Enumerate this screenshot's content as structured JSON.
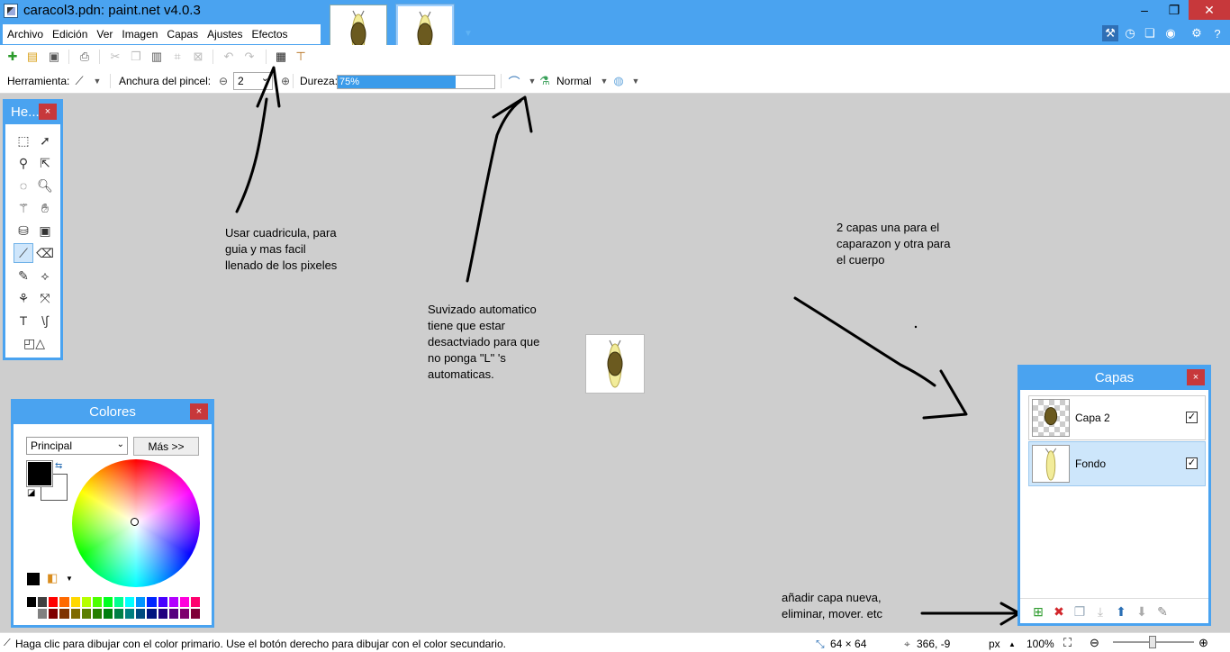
{
  "window": {
    "title": "caracol3.pdn: paint.net v4.0.3",
    "min_glyph": "–",
    "max_glyph": "❐",
    "close_glyph": "✕"
  },
  "menu": [
    "Archivo",
    "Edición",
    "Ver",
    "Imagen",
    "Capas",
    "Ajustes",
    "Efectos"
  ],
  "toolbar": {
    "tool_label": "Herramienta:",
    "brush_width_label": "Anchura del pincel:",
    "brush_width_value": "2",
    "hardness_label": "Dureza:",
    "hardness_value": "75%",
    "hardness_fraction": 0.75,
    "blend_mode": "Normal"
  },
  "tools_window": {
    "title": "He...",
    "close": "×"
  },
  "colors_window": {
    "title": "Colores",
    "close": "×",
    "palette_select": "Principal",
    "more_button": "Más >>"
  },
  "layers_window": {
    "title": "Capas",
    "close": "×",
    "layers": [
      {
        "name": "Capa 2",
        "visible": true
      },
      {
        "name": "Fondo",
        "visible": true
      }
    ]
  },
  "annotations": {
    "grid_note": "Usar cuadricula, para\nguia y mas facil\nllenado de los pixeles",
    "antialias_note": "Suvizado automatico\ntiene que estar\ndesactviado para que\nno ponga \"L\" 's\nautomaticas.",
    "layers_note": "2 capas una para el\ncaparazon y otra para\nel cuerpo",
    "layers_buttons_note": "añadir capa nueva,\neliminar, mover. etc"
  },
  "status": {
    "hint": "Haga clic para dibujar con el color primario. Use el botón derecho para dibujar con el color secundario.",
    "image_size": "64 × 64",
    "cursor_pos": "366, -9",
    "units": "px",
    "zoom": "100%"
  },
  "colors": {
    "accent": "#4aa3f0",
    "close": "#c7383b",
    "primary": "#000000",
    "secondary": "#ffffff"
  }
}
